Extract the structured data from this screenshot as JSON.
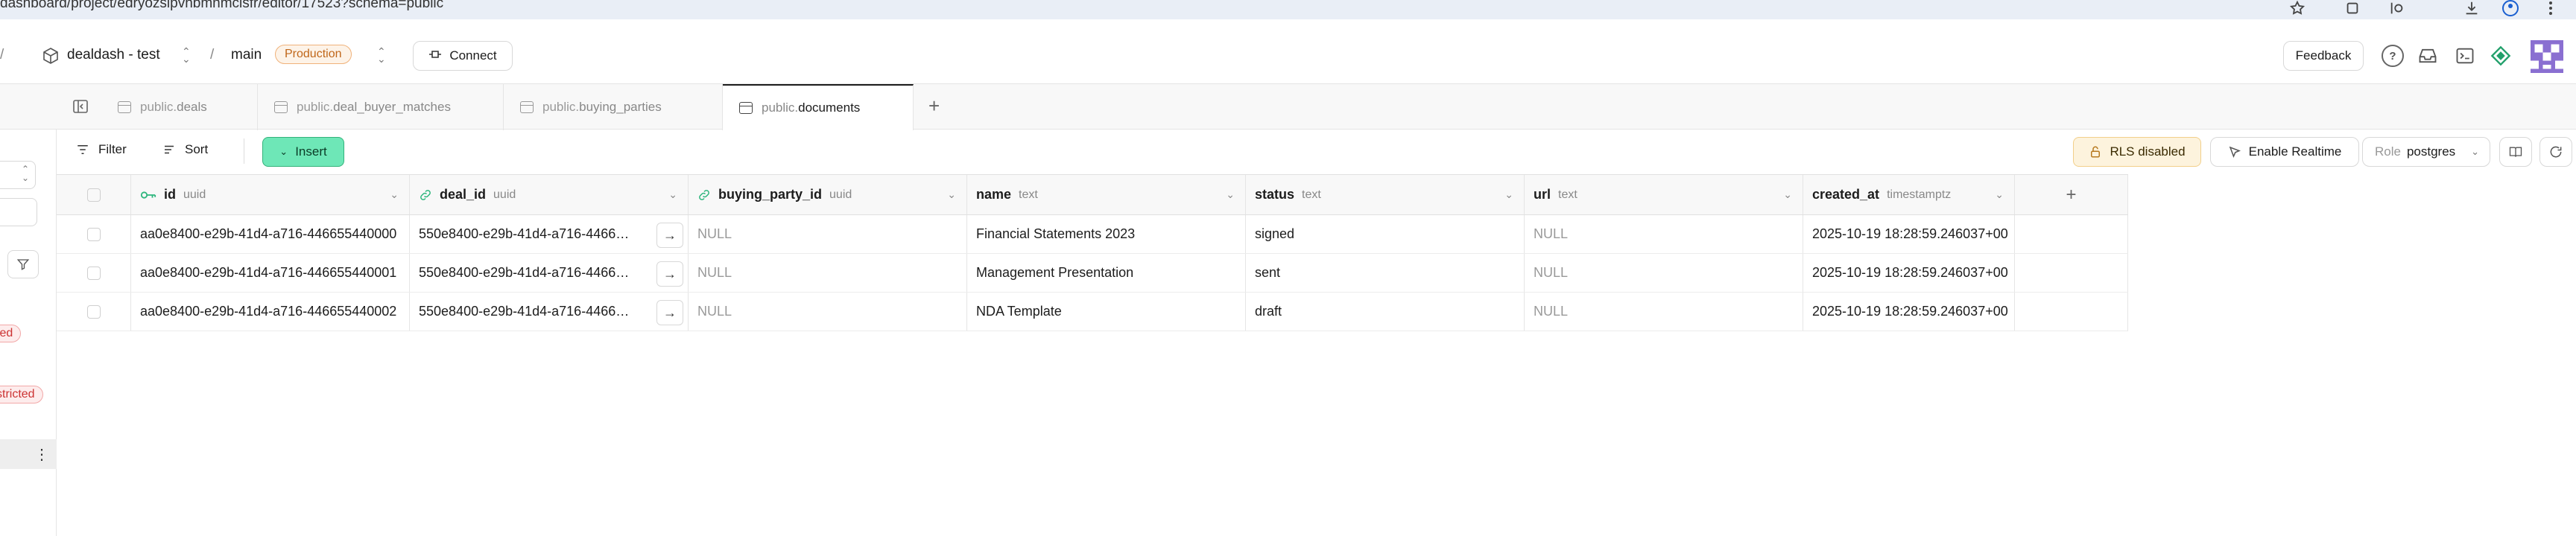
{
  "browser": {
    "url": "dashboard/project/edryozslpvhbmnmcisfr/editor/17523?schema=public"
  },
  "header": {
    "sep1": "/",
    "project": "dealdash - test",
    "sep2": "/",
    "branch": "main",
    "env_badge": "Production",
    "connect": "Connect",
    "feedback": "Feedback",
    "help": "?"
  },
  "tabs": [
    {
      "schema": "public.",
      "name": "deals"
    },
    {
      "schema": "public.",
      "name": "deal_buyer_matches"
    },
    {
      "schema": "public.",
      "name": "buying_parties"
    },
    {
      "schema": "public.",
      "name": "documents"
    }
  ],
  "new_tab": "+",
  "toolbar": {
    "filter": "Filter",
    "sort": "Sort",
    "insert": "Insert",
    "rls": "RLS disabled",
    "realtime": "Enable Realtime",
    "role_prefix": "Role",
    "role_value": "postgres"
  },
  "columns": [
    {
      "name": "id",
      "type": "uuid"
    },
    {
      "name": "deal_id",
      "type": "uuid"
    },
    {
      "name": "buying_party_id",
      "type": "uuid"
    },
    {
      "name": "name",
      "type": "text"
    },
    {
      "name": "status",
      "type": "text"
    },
    {
      "name": "url",
      "type": "text"
    },
    {
      "name": "created_at",
      "type": "timestamptz"
    }
  ],
  "add_column": "+",
  "rows": [
    {
      "id": "aa0e8400-e29b-41d4-a716-446655440000",
      "deal_id": "550e8400-e29b-41d4-a716-4466…",
      "buying_party_id": "NULL",
      "name": "Financial Statements 2023",
      "status": "signed",
      "url": "NULL",
      "created_at": "2025-10-19 18:28:59.246037+00"
    },
    {
      "id": "aa0e8400-e29b-41d4-a716-446655440001",
      "deal_id": "550e8400-e29b-41d4-a716-4466…",
      "buying_party_id": "NULL",
      "name": "Management Presentation",
      "status": "sent",
      "url": "NULL",
      "created_at": "2025-10-19 18:28:59.246037+00"
    },
    {
      "id": "aa0e8400-e29b-41d4-a716-446655440002",
      "deal_id": "550e8400-e29b-41d4-a716-4466…",
      "buying_party_id": "NULL",
      "name": "NDA Template",
      "status": "draft",
      "url": "NULL",
      "created_at": "2025-10-19 18:28:59.246037+00"
    }
  ],
  "sidebar": {
    "pill1": "ted",
    "pill2": "stricted",
    "more": "⋮"
  },
  "colors": {
    "insert_bg": "#6ee7b7",
    "production": "#c0671a",
    "rls_bg": "#fdf3dd"
  }
}
